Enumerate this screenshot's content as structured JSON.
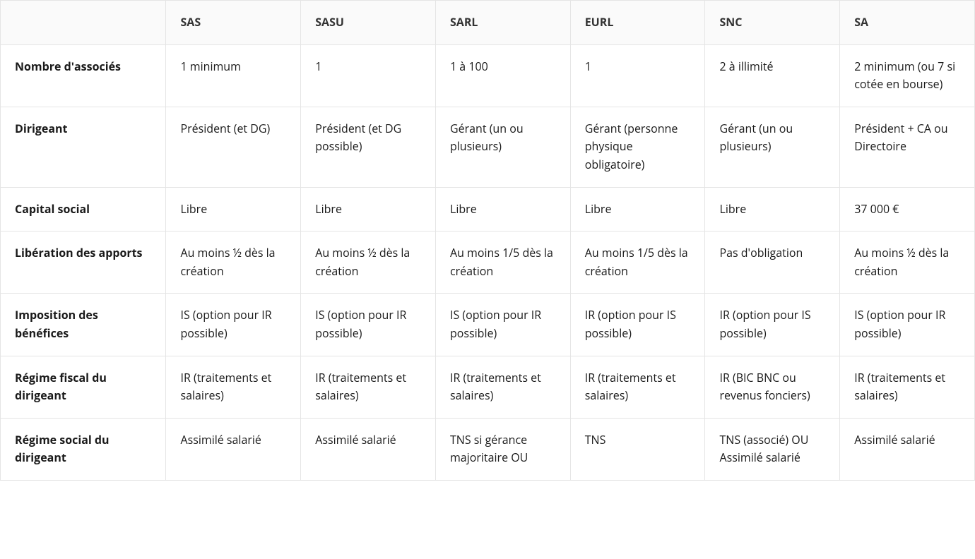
{
  "table": {
    "columns": [
      "SAS",
      "SASU",
      "SARL",
      "EURL",
      "SNC",
      "SA"
    ],
    "rows": [
      {
        "label": "Nombre d'associés",
        "values": [
          "1 minimum",
          "1",
          "1 à 100",
          "1",
          "2 à illimité",
          "2 minimum (ou 7 si cotée en bourse)"
        ]
      },
      {
        "label": "Dirigeant",
        "values": [
          "Président (et DG)",
          "Président (et DG possible)",
          "Gérant (un ou plusieurs)",
          "Gérant (personne physique obligatoire)",
          "Gérant (un ou plusieurs)",
          "Président + CA ou Directoire"
        ]
      },
      {
        "label": "Capital social",
        "values": [
          "Libre",
          "Libre",
          "Libre",
          "Libre",
          "Libre",
          "37 000 €"
        ]
      },
      {
        "label": "Libération des apports",
        "values": [
          "Au moins ½ dès la création",
          "Au moins ½ dès la création",
          "Au moins 1/5 dès la création",
          "Au moins 1/5 dès la création",
          "Pas d'obligation",
          "Au moins ½ dès la création"
        ]
      },
      {
        "label": "Imposition des bénéfices",
        "values": [
          "IS (option pour IR possible)",
          "IS (option pour IR possible)",
          "IS (option pour IR possible)",
          "IR (option pour IS possible)",
          "IR (option pour IS possible)",
          "IS (option pour IR possible)"
        ]
      },
      {
        "label": "Régime fiscal du dirigeant",
        "values": [
          "IR (traitements et salaires)",
          "IR (traitements et salaires)",
          "IR (traitements et salaires)",
          "IR (traitements et salaires)",
          "IR (BIC BNC ou revenus fonciers)",
          "IR (traitements et salaires)"
        ]
      },
      {
        "label": "Régime social du dirigeant",
        "values": [
          "Assimilé salarié",
          "Assimilé salarié",
          "TNS si gérance majoritaire OU",
          "TNS",
          "TNS (associé) OU Assimilé salarié",
          "Assimilé salarié"
        ]
      }
    ]
  }
}
